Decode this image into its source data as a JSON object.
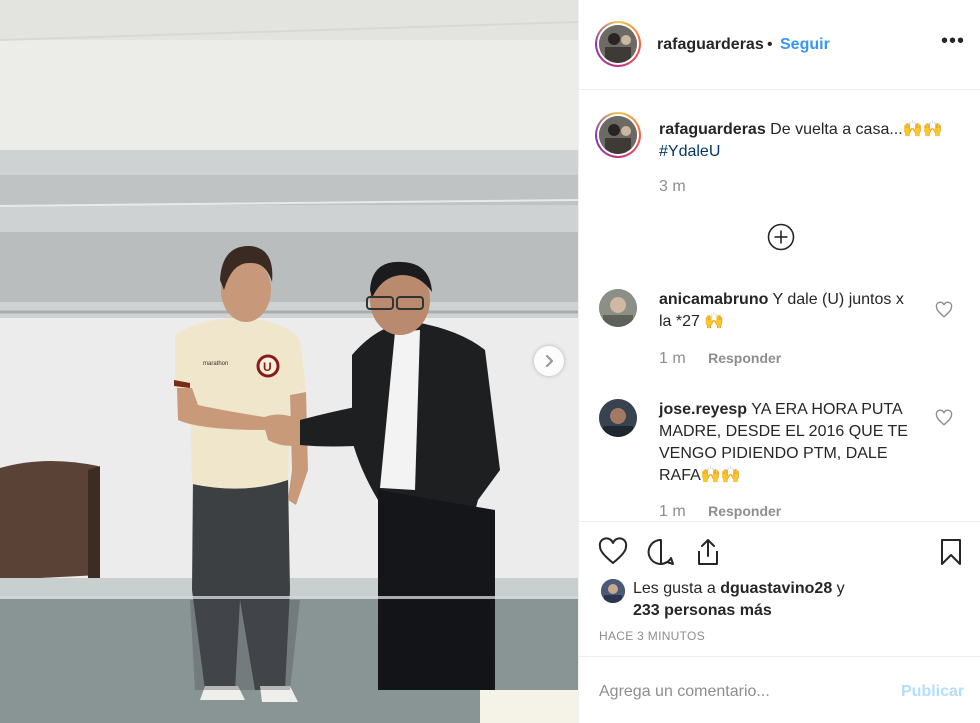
{
  "header": {
    "username": "rafaguarderas",
    "separator": "•",
    "follow_label": "Seguir",
    "more_glyph": "•••"
  },
  "caption": {
    "username": "rafaguarderas",
    "text": "De vuelta a casa...🙌🙌",
    "hashtag": "#YdaleU",
    "time": "3 m"
  },
  "comments": [
    {
      "username": "anicamabruno",
      "text": "Y dale (U) juntos x la *27 🙌",
      "time": "1 m",
      "reply_label": "Responder"
    },
    {
      "username": "jose.reyesp",
      "text": "YA ERA HORA PUTA MADRE, DESDE EL 2016 QUE TE VENGO PIDIENDO PTM, DALE RAFA🙌🙌",
      "time": "1 m",
      "reply_label": "Responder"
    }
  ],
  "likes": {
    "prefix": "Les gusta a",
    "user": "dguastavino28",
    "conjunction": "y",
    "others": "233 personas más"
  },
  "posted_ago": "HACE 3 MINUTOS",
  "add_comment": {
    "placeholder": "Agrega un comentario...",
    "publish_label": "Publicar"
  },
  "icons": {
    "like": "heart-outline-icon",
    "comment": "speech-bubble-icon",
    "share": "share-upload-icon",
    "save": "bookmark-icon",
    "load_more": "plus-circle-icon",
    "next": "chevron-right-icon",
    "more": "more-options-icon"
  },
  "colors": {
    "link_blue": "#3897f0",
    "hashtag": "#00376b",
    "muted": "#8e8e8e",
    "publish_disabled": "#b2dffc",
    "jersey": "#efe6cc",
    "jersey_accent": "#8b1a1a"
  }
}
